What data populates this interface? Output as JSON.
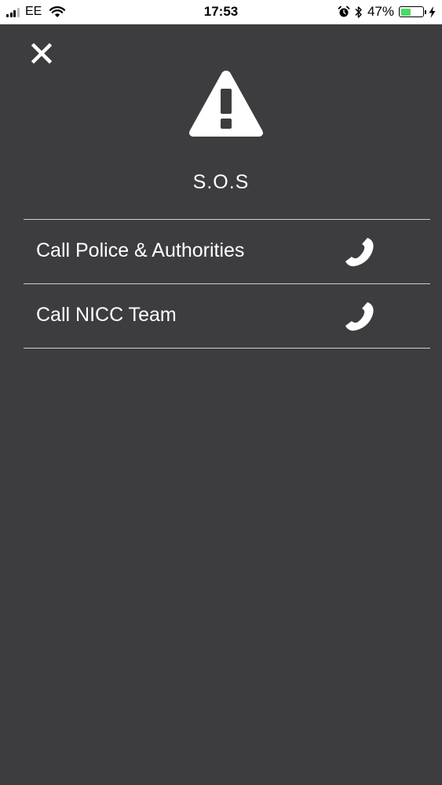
{
  "status_bar": {
    "carrier": "EE",
    "time": "17:53",
    "battery_percent_text": "47%",
    "battery_level": 0.47,
    "icons": [
      "signal-icon",
      "wifi-icon",
      "alarm-icon",
      "bluetooth-icon",
      "battery-icon",
      "charging-icon"
    ]
  },
  "header": {
    "title": "S.O.S",
    "icons": [
      "close-icon",
      "warning-icon"
    ]
  },
  "menu": {
    "items": [
      {
        "label": "Call Police & Authorities",
        "icon": "phone-icon"
      },
      {
        "label": "Call NICC Team",
        "icon": "phone-icon"
      }
    ]
  },
  "colors": {
    "background": "#3d3c3f",
    "text": "#ffffff",
    "divider": "#cfcfcf",
    "battery": "#4cd964"
  }
}
